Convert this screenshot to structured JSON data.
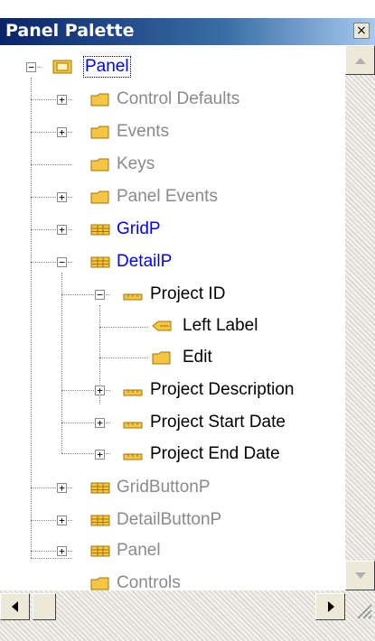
{
  "window": {
    "title": "Panel Palette",
    "close_glyph": "×"
  },
  "tree": [
    {
      "label": "Panel",
      "state": "expanded",
      "color": "blue",
      "icon": "panel-icon",
      "selected": true
    },
    {
      "label": "Control Defaults",
      "state": "collapsed",
      "color": "gray",
      "icon": "folder-icon"
    },
    {
      "label": "Events",
      "state": "collapsed",
      "color": "gray",
      "icon": "folder-icon"
    },
    {
      "label": "Keys",
      "state": "leaf",
      "color": "gray",
      "icon": "folder-icon"
    },
    {
      "label": "Panel Events",
      "state": "collapsed",
      "color": "gray",
      "icon": "folder-icon"
    },
    {
      "label": "GridP",
      "state": "collapsed",
      "color": "blue",
      "icon": "grid-icon"
    },
    {
      "label": "DetailP",
      "state": "expanded",
      "color": "blue",
      "icon": "grid-icon"
    },
    {
      "label": "Project ID",
      "state": "expanded",
      "color": "black",
      "icon": "field-icon"
    },
    {
      "label": "Left Label",
      "state": "leaf",
      "color": "black",
      "icon": "label-icon"
    },
    {
      "label": "Edit",
      "state": "leaf",
      "color": "black",
      "icon": "folder-icon"
    },
    {
      "label": "Project Description",
      "state": "collapsed",
      "color": "black",
      "icon": "field-icon"
    },
    {
      "label": "Project Start Date",
      "state": "collapsed",
      "color": "black",
      "icon": "field-icon"
    },
    {
      "label": "Project End Date",
      "state": "collapsed",
      "color": "black",
      "icon": "field-icon"
    },
    {
      "label": "GridButtonP",
      "state": "collapsed",
      "color": "gray",
      "icon": "grid-icon"
    },
    {
      "label": "DetailButtonP",
      "state": "collapsed",
      "color": "gray",
      "icon": "grid-icon"
    },
    {
      "label": "Panel",
      "state": "collapsed",
      "color": "gray",
      "icon": "grid-icon"
    },
    {
      "label": "Controls",
      "state": "leaf",
      "color": "gray",
      "icon": "folder-icon"
    }
  ],
  "colors": {
    "title_bar_start": "#0a246a",
    "link_blue": "#0000ff",
    "disabled_gray": "#8a8a8a",
    "folder_yellow": "#f6c544"
  }
}
